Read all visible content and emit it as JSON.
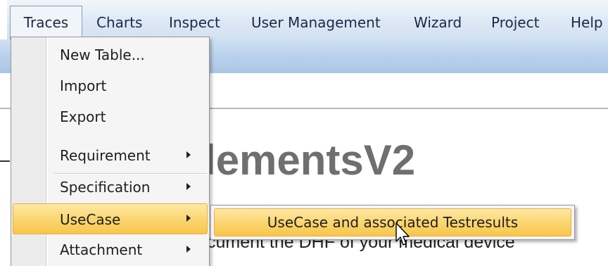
{
  "menubar": {
    "items": [
      {
        "label": "Traces",
        "active": true
      },
      {
        "label": "Charts"
      },
      {
        "label": "Inspect"
      },
      {
        "label": "User Management"
      },
      {
        "label": "Wizard"
      },
      {
        "label": "Project"
      },
      {
        "label": "Help"
      }
    ]
  },
  "document": {
    "title_partial": "ElementsV2",
    "subtitle_partial": "cument the DHF of your medical device"
  },
  "dropdown": {
    "items": [
      {
        "label": "New Table..."
      },
      {
        "label": "Import"
      },
      {
        "label": "Export"
      },
      {
        "label": "Requirement",
        "submenu": true
      },
      {
        "label": "Specification",
        "submenu": true
      },
      {
        "label": "UseCase",
        "submenu": true,
        "highlighted": true
      },
      {
        "label": "Attachment",
        "submenu": true
      }
    ]
  },
  "submenu": {
    "items": [
      {
        "label": "UseCase and associated Testresults",
        "highlighted": true
      }
    ]
  },
  "colors": {
    "menubar_bg": "#dde8f5",
    "toolbar_bg": "#b9d1ec",
    "highlight": "#fbd876",
    "highlight_border": "#e6b13c",
    "menu_bg": "#f5f5f5",
    "title_gray": "#6f6f6f"
  }
}
